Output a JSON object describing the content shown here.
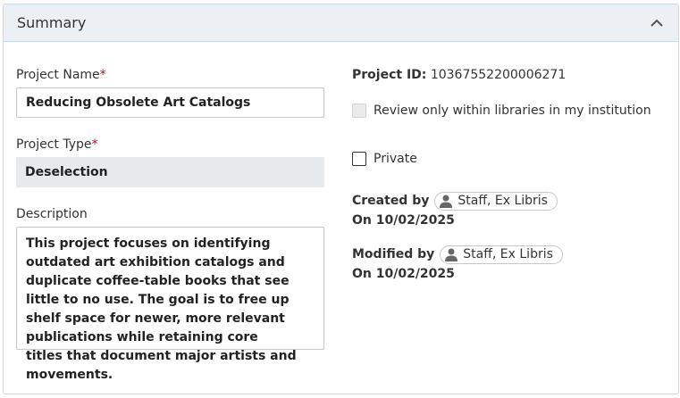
{
  "panel": {
    "title": "Summary",
    "collapse_icon": "chevron-up-icon"
  },
  "left": {
    "project_name": {
      "label": "Project Name",
      "required_mark": "*",
      "value": "Reducing Obsolete Art Catalogs"
    },
    "project_type": {
      "label": "Project Type",
      "required_mark": "*",
      "value": "Deselection"
    },
    "description": {
      "label": "Description",
      "value": "This project focuses on identifying outdated art exhibition catalogs and duplicate coffee-table books that see little to no use. The goal is to free up shelf space for newer, more relevant publications while retaining core titles that document major artists and movements."
    }
  },
  "right": {
    "project_id": {
      "label": "Project ID:",
      "value": "10367552200006271"
    },
    "review_within_libraries": {
      "label": "Review only within libraries in my institution",
      "checked": false,
      "disabled": true
    },
    "private": {
      "label": "Private",
      "checked": false
    },
    "created": {
      "label": "Created by",
      "user": "Staff, Ex Libris",
      "date": "On 10/02/2025",
      "icon": "user-icon"
    },
    "modified": {
      "label": "Modified by",
      "user": "Staff, Ex Libris",
      "date": "On 10/02/2025",
      "icon": "user-icon"
    }
  },
  "colors": {
    "header_bg": "#ecf0f4",
    "border": "#c8d9e6",
    "required": "#d0021b",
    "select_bg": "#e7eaed"
  }
}
